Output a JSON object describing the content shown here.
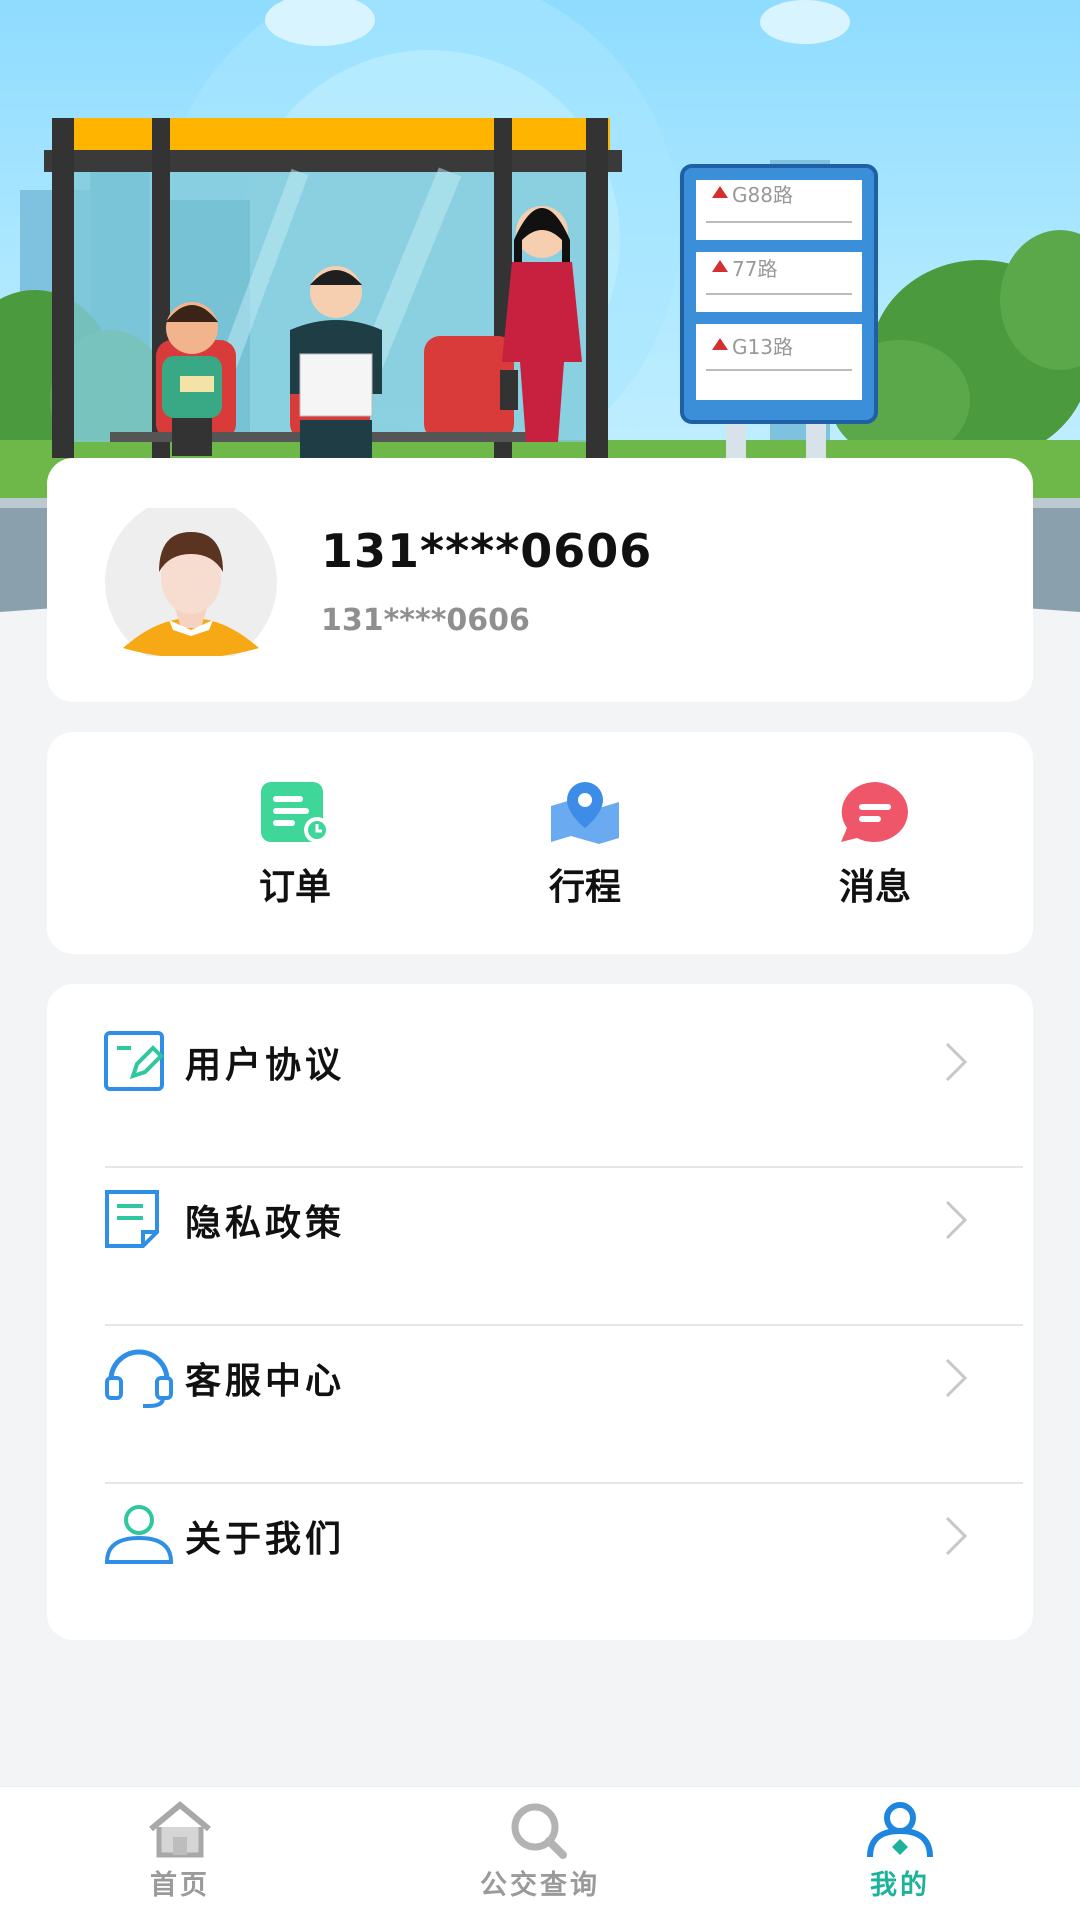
{
  "hero": {
    "bus_sign": {
      "routes": [
        "G88路",
        "77路",
        "G13路"
      ]
    }
  },
  "profile": {
    "phone_main": "131****0606",
    "phone_sub": "131****0606"
  },
  "quick_actions": [
    {
      "label": "订单",
      "icon": "order-icon",
      "color": "#3ed699"
    },
    {
      "label": "行程",
      "icon": "map-pin-icon",
      "color": "#6aaaf0"
    },
    {
      "label": "消息",
      "icon": "message-icon",
      "color": "#f0566a"
    }
  ],
  "menu": [
    {
      "label": "用户协议",
      "icon": "agreement-edit-icon"
    },
    {
      "label": "隐私政策",
      "icon": "privacy-document-icon"
    },
    {
      "label": "客服中心",
      "icon": "headset-icon"
    },
    {
      "label": "关于我们",
      "icon": "person-icon"
    }
  ],
  "tabbar": {
    "items": [
      {
        "label": "首页",
        "icon": "home-icon"
      },
      {
        "label": "公交查询",
        "icon": "search-icon"
      },
      {
        "label": "我的",
        "icon": "profile-icon"
      }
    ],
    "active_index": 2,
    "active_color": "#1cb39a"
  }
}
